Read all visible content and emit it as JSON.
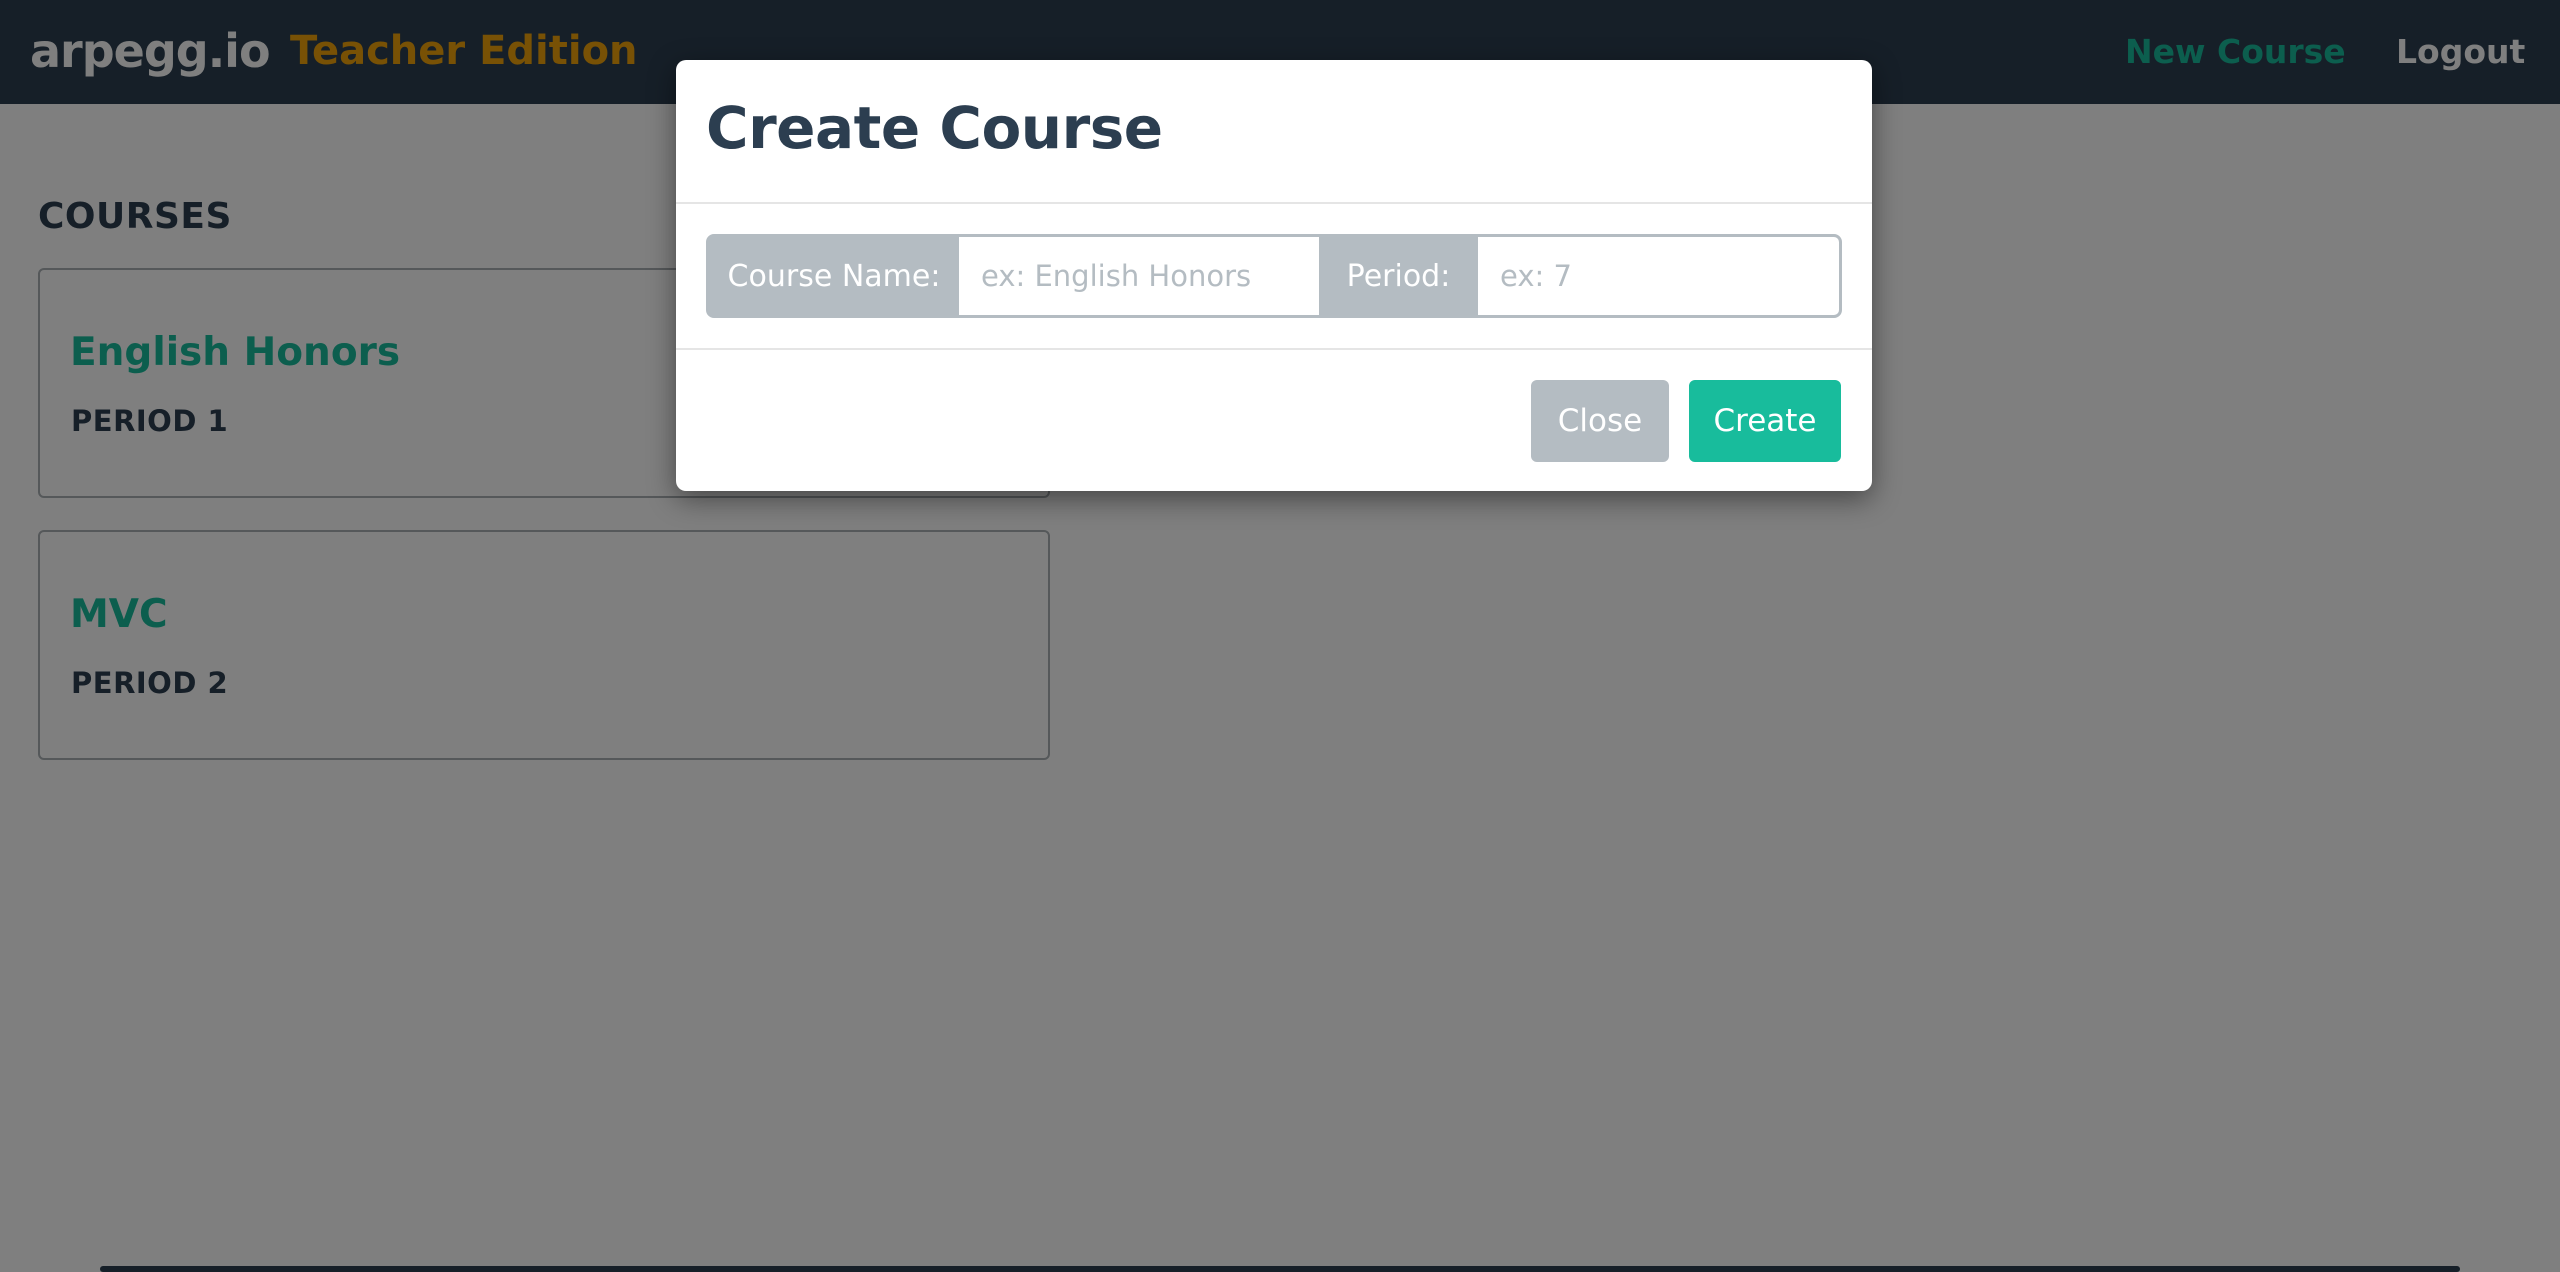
{
  "navbar": {
    "brand": "arpegg.io",
    "edition": "Teacher Edition",
    "new_course_label": "New Course",
    "logout_label": "Logout"
  },
  "courses_section": {
    "title": "COURSES",
    "courses": [
      {
        "name": "English Honors",
        "period": "PERIOD 1"
      },
      {
        "name": "MVC",
        "period": "PERIOD 2"
      }
    ]
  },
  "modal": {
    "title": "Create Course",
    "course_name_label": "Course Name:",
    "course_name_placeholder": "ex: English Honors",
    "course_name_value": "",
    "period_label": "Period:",
    "period_placeholder": "ex: 7",
    "period_value": "",
    "close_label": "Close",
    "create_label": "Create"
  },
  "colors": {
    "navbar_bg": "#2c3e50",
    "brand_accent": "#f0a30a",
    "primary": "#18bc9c",
    "muted": "#b4bcc2",
    "text_dark": "#2c3e50"
  }
}
